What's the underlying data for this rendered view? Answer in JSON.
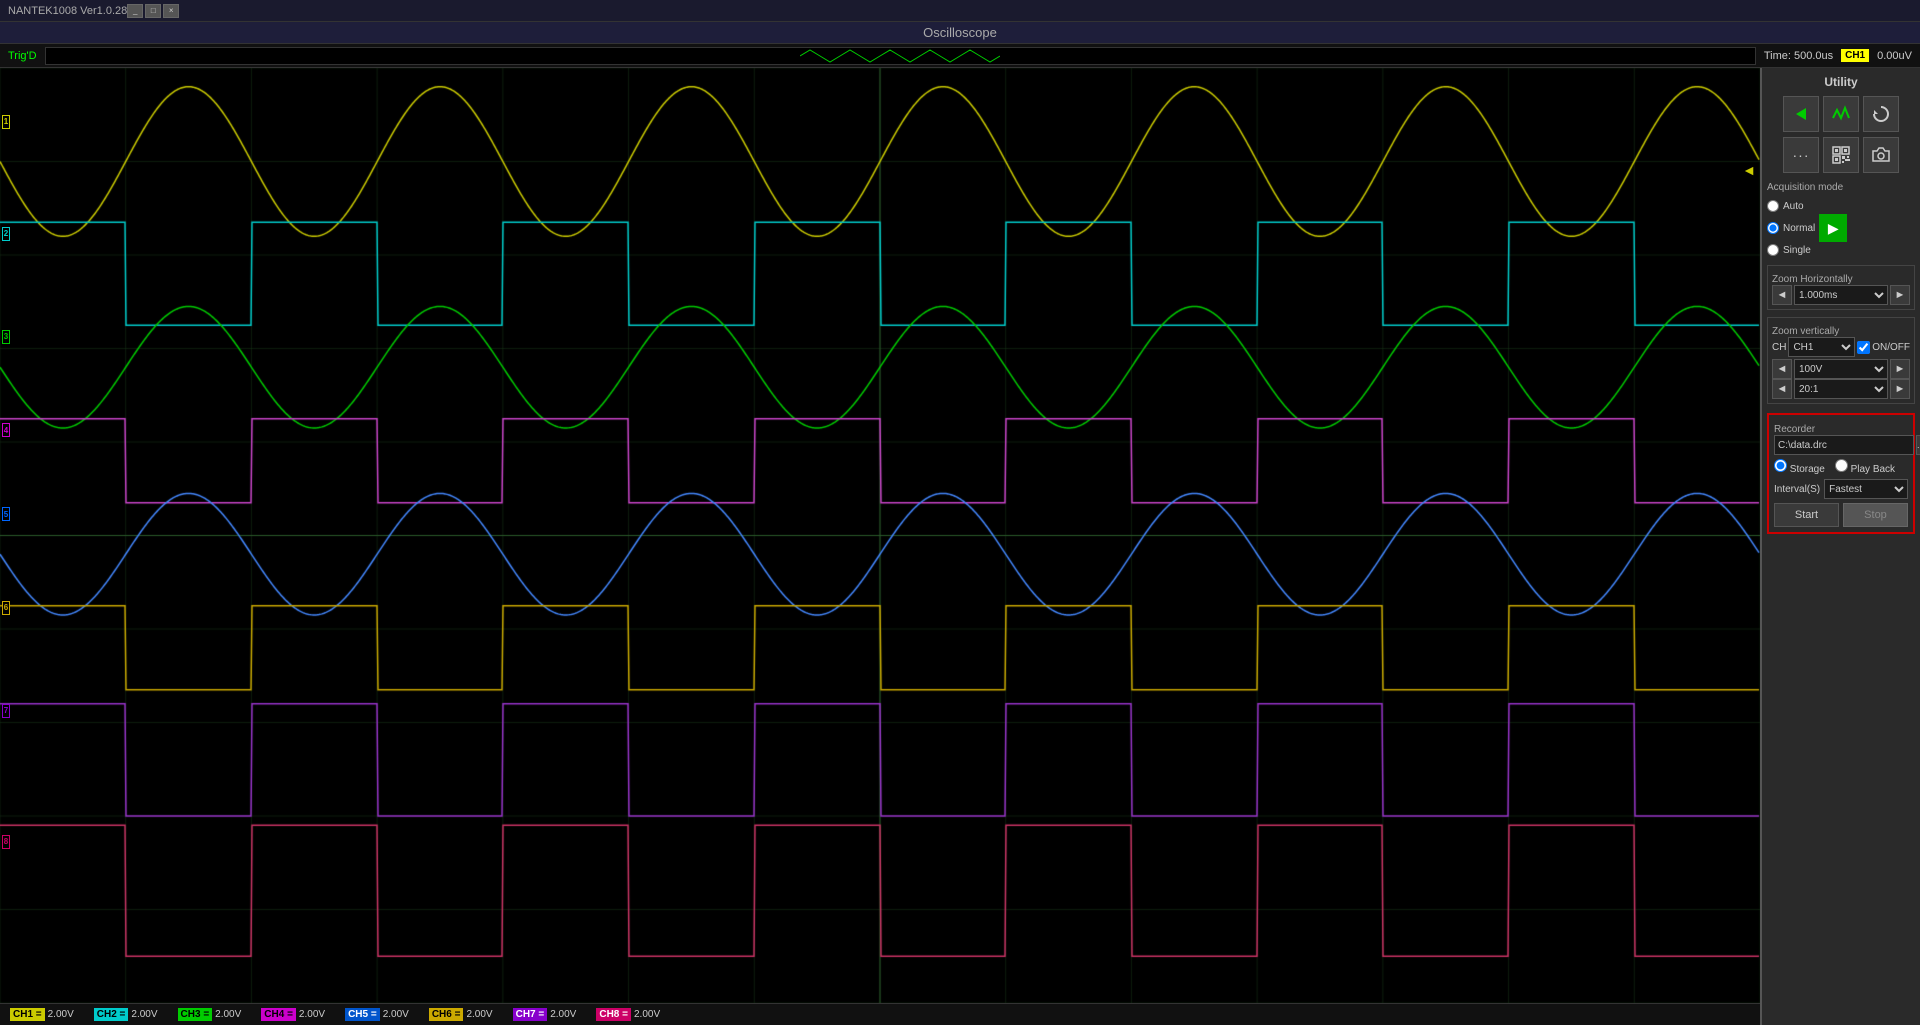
{
  "app": {
    "title": "NANTEK1008 Ver1.0.28",
    "osc_title": "Oscilloscope",
    "win_controls": [
      "_",
      "□",
      "×"
    ]
  },
  "status_bar": {
    "trig_label": "Trig'D",
    "time_display": "Time: 500.0us",
    "ch_indicator": "CH1",
    "voltage_display": "0.00uV"
  },
  "channels": {
    "bottom_bar": [
      {
        "label": "CH1 =",
        "value": "2.00V",
        "color": "#cccc00"
      },
      {
        "label": "CH2 =",
        "value": "2.00V",
        "color": "#00cccc"
      },
      {
        "label": "CH3 =",
        "value": "2.00V",
        "color": "#00cc00"
      },
      {
        "label": "CH4 =",
        "value": "2.00V",
        "color": "#cc00cc"
      },
      {
        "label": "CH5 =",
        "value": "2.00V",
        "color": "#0066ff"
      },
      {
        "label": "CH6 =",
        "value": "2.00V",
        "color": "#ccaa00"
      },
      {
        "label": "CH7 =",
        "value": "2.00V",
        "color": "#8800cc"
      },
      {
        "label": "CH8 =",
        "value": "2.00V",
        "color": "#cc0066"
      }
    ]
  },
  "right_panel": {
    "utility_label": "Utility",
    "acquisition_mode": {
      "label": "Acquisition mode",
      "options": [
        "Auto",
        "Normal",
        "Single"
      ],
      "selected": "Normal"
    },
    "zoom_h": {
      "label": "Zoom Horizontally",
      "value": "1.000ms"
    },
    "zoom_v": {
      "label": "Zoom vertically",
      "ch_label": "CH",
      "ch_value": "CH1",
      "onoff_label": "ON/OFF",
      "v_value": "100V",
      "ratio_value": "20:1"
    },
    "recorder": {
      "label": "Recorder",
      "path": "C:\\data.drc",
      "browse_label": "...",
      "storage_label": "Storage",
      "playback_label": "Play Back",
      "interval_label": "Interval(S)",
      "interval_value": "Fastest",
      "start_label": "Start",
      "stop_label": "Stop"
    }
  },
  "grid": {
    "cols": 14,
    "rows": 10,
    "color": "#1a3a1a"
  }
}
